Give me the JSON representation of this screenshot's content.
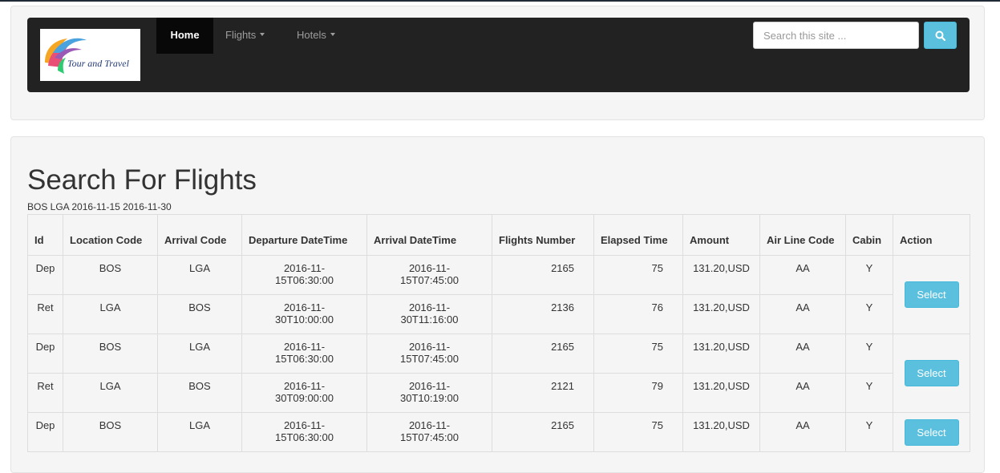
{
  "brand": {
    "logo_text": "Tour and Travel"
  },
  "nav": {
    "home": "Home",
    "flights": "Flights",
    "hotels": "Hotels"
  },
  "search": {
    "placeholder": "Search this site ..."
  },
  "page": {
    "title": "Search For Flights",
    "criteria": "BOS LGA 2016-11-15 2016-11-30"
  },
  "table": {
    "headers": {
      "id": "Id",
      "location_code": "Location Code",
      "arrival_code": "Arrival Code",
      "departure_datetime": "Departure DateTime",
      "arrival_datetime": "Arrival DateTime",
      "flights_number": "Flights Number",
      "elapsed_time": "Elapsed Time",
      "amount": "Amount",
      "airline_code": "Air Line Code",
      "cabin": "Cabin",
      "action": "Action"
    },
    "select_label": "Select",
    "rows": [
      {
        "id": "Dep",
        "loc": "BOS",
        "arr": "LGA",
        "dep_date": "2016-11-",
        "dep_time": "15T06:30:00",
        "arr_date": "2016-11-",
        "arr_time": "15T07:45:00",
        "flight": "2165",
        "elapsed": "75",
        "amount": "131.20,USD",
        "airline": "AA",
        "cabin": "Y"
      },
      {
        "id": "Ret",
        "loc": "LGA",
        "arr": "BOS",
        "dep_date": "2016-11-",
        "dep_time": "30T10:00:00",
        "arr_date": "2016-11-",
        "arr_time": "30T11:16:00",
        "flight": "2136",
        "elapsed": "76",
        "amount": "131.20,USD",
        "airline": "AA",
        "cabin": "Y"
      },
      {
        "id": "Dep",
        "loc": "BOS",
        "arr": "LGA",
        "dep_date": "2016-11-",
        "dep_time": "15T06:30:00",
        "arr_date": "2016-11-",
        "arr_time": "15T07:45:00",
        "flight": "2165",
        "elapsed": "75",
        "amount": "131.20,USD",
        "airline": "AA",
        "cabin": "Y"
      },
      {
        "id": "Ret",
        "loc": "LGA",
        "arr": "BOS",
        "dep_date": "2016-11-",
        "dep_time": "30T09:00:00",
        "arr_date": "2016-11-",
        "arr_time": "30T10:19:00",
        "flight": "2121",
        "elapsed": "79",
        "amount": "131.20,USD",
        "airline": "AA",
        "cabin": "Y"
      },
      {
        "id": "Dep",
        "loc": "BOS",
        "arr": "LGA",
        "dep_date": "2016-11-",
        "dep_time": "15T06:30:00",
        "arr_date": "2016-11-",
        "arr_time": "15T07:45:00",
        "flight": "2165",
        "elapsed": "75",
        "amount": "131.20,USD",
        "airline": "AA",
        "cabin": "Y"
      }
    ]
  },
  "colors": {
    "navbar": "#222222",
    "accent": "#5bc0de",
    "panel": "#f5f5f5"
  },
  "icons": {
    "search": "search-icon",
    "caret": "caret-down-icon"
  }
}
